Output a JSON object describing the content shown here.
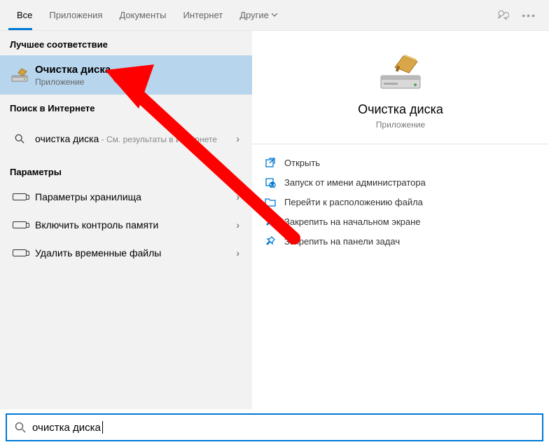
{
  "tabs": {
    "items": [
      "Все",
      "Приложения",
      "Документы",
      "Интернет",
      "Другие"
    ],
    "active_index": 0
  },
  "left": {
    "groups": [
      {
        "header": "Лучшее соответствие",
        "items": [
          {
            "title": "Очистка диска",
            "subtitle": "Приложение",
            "selected": true,
            "icon": "disk-cleanup"
          }
        ]
      },
      {
        "header": "Поиск в Интернете",
        "items": [
          {
            "title": "очистка диска",
            "inline_sub": " - См. результаты в Интернете",
            "icon": "search",
            "chevron": true
          }
        ]
      },
      {
        "header": "Параметры",
        "items": [
          {
            "title": "Параметры хранилища",
            "icon": "storage",
            "chevron": true
          },
          {
            "title": "Включить контроль памяти",
            "icon": "storage",
            "chevron": true
          },
          {
            "title": "Удалить временные файлы",
            "icon": "storage",
            "chevron": true
          }
        ]
      }
    ]
  },
  "detail": {
    "title": "Очистка диска",
    "subtitle": "Приложение",
    "actions": [
      {
        "label": "Открыть",
        "icon": "open"
      },
      {
        "label": "Запуск от имени администратора",
        "icon": "admin"
      },
      {
        "label": "Перейти к расположению файла",
        "icon": "folder"
      },
      {
        "label": "Закрепить на начальном экране",
        "icon": "pin-start"
      },
      {
        "label": "Закрепить на панели задач",
        "icon": "pin-taskbar"
      }
    ]
  },
  "search": {
    "query": "очистка диска"
  }
}
